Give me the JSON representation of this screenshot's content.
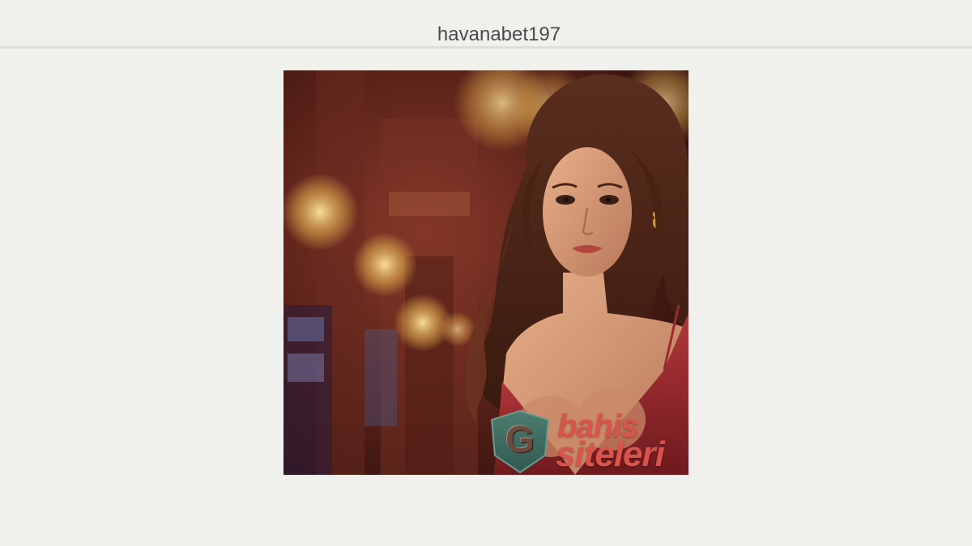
{
  "header": {
    "title": "havanabet197"
  },
  "hero_image": {
    "logo_letter": "G",
    "logo_line1": "bahis",
    "logo_line2": "siteleri",
    "colors": {
      "logo_text": "#d9544a",
      "shield": "#3f6b61",
      "dress": "#9b2a2e",
      "background": "#f0f0ed"
    }
  }
}
